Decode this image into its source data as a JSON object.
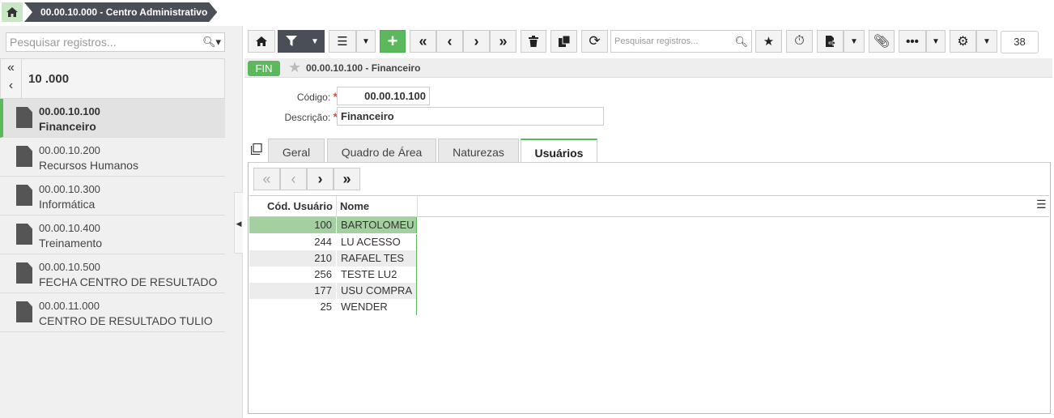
{
  "breadcrumb": {
    "home_icon": "home-icon",
    "current": "00.00.10.000 - Centro Administrativo"
  },
  "sidebar": {
    "search_placeholder": "Pesquisar registros...",
    "header_title": "10 .000",
    "items": [
      {
        "code": "00.00.10.100",
        "name": "Financeiro",
        "active": true
      },
      {
        "code": "00.00.10.200",
        "name": "Recursos Humanos",
        "active": false
      },
      {
        "code": "00.00.10.300",
        "name": "Informática",
        "active": false
      },
      {
        "code": "00.00.10.400",
        "name": "Treinamento",
        "active": false
      },
      {
        "code": "00.00.10.500",
        "name": "FECHA CENTRO DE RESULTADO",
        "active": false
      },
      {
        "code": "00.00.11.000",
        "name": "CENTRO DE RESULTADO TULIO",
        "active": false
      }
    ]
  },
  "toolbar": {
    "search_placeholder": "Pesquisar registros...",
    "counter": "38"
  },
  "record": {
    "badge": "FIN",
    "title": "00.00.10.100 - Financeiro"
  },
  "form": {
    "codigo_label": "Código:",
    "codigo_value": "00.00.10.100",
    "descricao_label": "Descrição:",
    "descricao_value": "Financeiro"
  },
  "tabs": [
    "Geral",
    "Quadro de Área",
    "Naturezas",
    "Usuários"
  ],
  "grid": {
    "columns": [
      "Cód. Usuário",
      "Nome"
    ],
    "rows": [
      {
        "code": "100",
        "name": "BARTOLOMEU"
      },
      {
        "code": "244",
        "name": "LU ACESSO"
      },
      {
        "code": "210",
        "name": "RAFAEL TES"
      },
      {
        "code": "256",
        "name": "TESTE LU2"
      },
      {
        "code": "177",
        "name": "USU COMPRA"
      },
      {
        "code": "25",
        "name": "WENDER"
      }
    ]
  },
  "colors": {
    "accent": "#5cb85c",
    "dark": "#4a4f57",
    "selected_row": "#a3cfa1"
  }
}
